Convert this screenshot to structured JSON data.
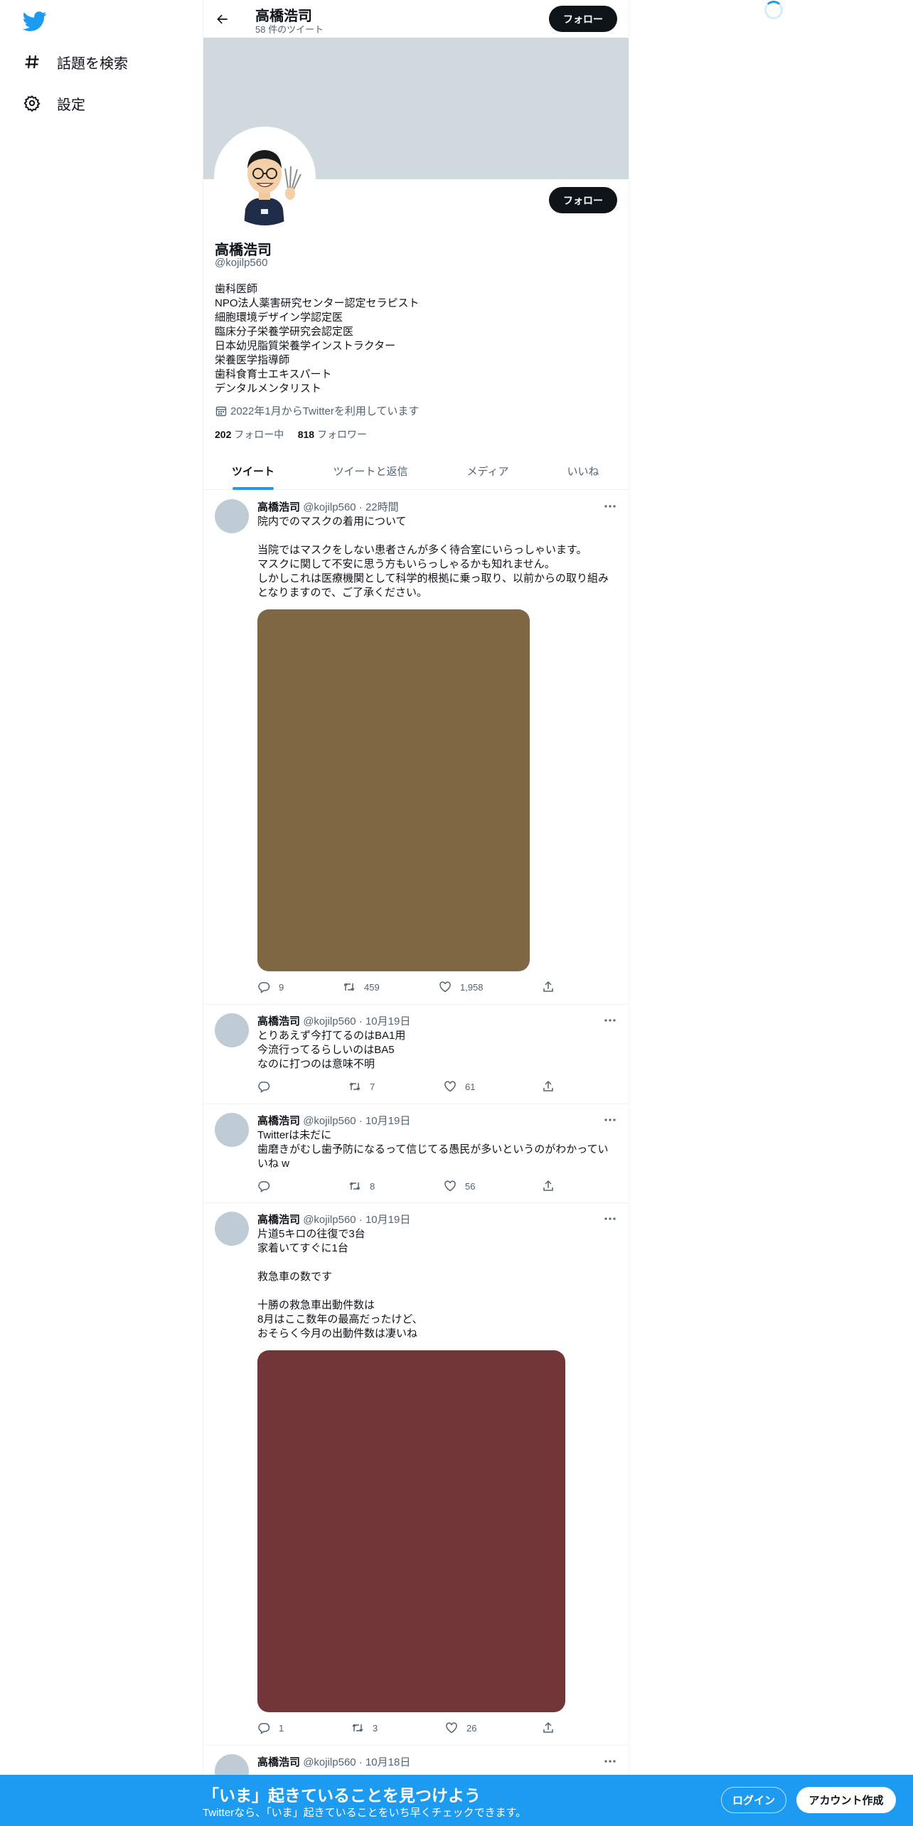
{
  "sidebar": {
    "items": [
      {
        "label": "話題を検索",
        "icon": "hashtag-icon"
      },
      {
        "label": "設定",
        "icon": "gear-icon"
      }
    ]
  },
  "header": {
    "name": "高橋浩司",
    "tweet_count": "58 件のツイート",
    "follow_label": "フォロー"
  },
  "profile": {
    "name": "高橋浩司",
    "handle": "@kojilp560",
    "follow_label": "フォロー",
    "bio": [
      "歯科医師",
      "NPO法人薬害研究センター認定セラピスト",
      "細胞環境デザイン学認定医",
      "臨床分子栄養学研究会認定医",
      "日本幼児脂質栄養学インストラクター",
      "栄養医学指導師",
      "歯科食育士エキスパート",
      "デンタルメンタリスト"
    ],
    "joined": "2022年1月からTwitterを利用しています",
    "following_count": "202",
    "following_label": "フォロー中",
    "followers_count": "818",
    "followers_label": "フォロワー"
  },
  "tabs": [
    {
      "label": "ツイート"
    },
    {
      "label": "ツイートと返信"
    },
    {
      "label": "メディア"
    },
    {
      "label": "いいね"
    }
  ],
  "tweets": [
    {
      "name": "高橋浩司",
      "meta": "@kojilp560 · 22時間",
      "lines": [
        "院内でのマスクの着用について",
        "",
        "当院ではマスクをしない患者さんが多く待合室にいらっしゃいます。",
        "マスクに関して不安に思う方もいらっしゃるかも知れません。",
        "しかしこれは医療機関として科学的根拠に乗っ取り、以前からの取り組み",
        "となりますので、ご了承ください。"
      ],
      "media_color": "#7f6744",
      "replies": "9",
      "retweets": "459",
      "likes": "1,958"
    },
    {
      "name": "高橋浩司",
      "meta": "@kojilp560 · 10月19日",
      "lines": [
        "とりあえず今打てるのはBA1用",
        "今流行ってるらしいのはBA5",
        "なのに打つのは意味不明"
      ],
      "replies": "",
      "retweets": "7",
      "likes": "61"
    },
    {
      "name": "高橋浩司",
      "meta": "@kojilp560 · 10月19日",
      "lines": [
        "Twitterは未だに",
        "歯磨きがむし歯予防になるって信じてる愚民が多いというのがわかってい",
        "いね w"
      ],
      "replies": "",
      "retweets": "8",
      "likes": "56"
    },
    {
      "name": "高橋浩司",
      "meta": "@kojilp560 · 10月19日",
      "lines": [
        "片道5キロの往復で3台",
        "家着いてすぐに1台",
        "",
        "救急車の数です",
        "",
        "十勝の救急車出動件数は",
        "8月はここ数年の最高だったけど、",
        "おそらく今月の出動件数は凄いね"
      ],
      "media_color": "#723538",
      "replies": "1",
      "retweets": "3",
      "likes": "26"
    },
    {
      "name": "高橋浩司",
      "meta": "@kojilp560 · 10月18日"
    }
  ],
  "bottom_banner": {
    "title": "「いま」起きていることを見つけよう",
    "subtitle": "Twitterなら、「いま」起きていることをいち早くチェックできます。",
    "login_label": "ログイン",
    "signup_label": "アカウント作成"
  },
  "colors": {
    "accent": "#1d9bf0",
    "banner": "#cfd9de"
  }
}
